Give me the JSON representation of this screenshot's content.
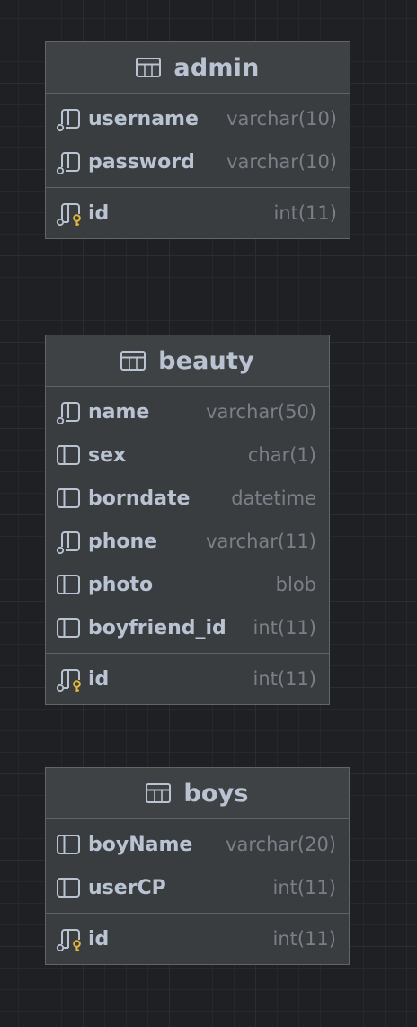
{
  "tables": [
    {
      "name": "admin",
      "columns": [
        {
          "name": "username",
          "type": "varchar(10)",
          "icon": "nullable-column-icon"
        },
        {
          "name": "password",
          "type": "varchar(10)",
          "icon": "nullable-column-icon"
        }
      ],
      "primary_key": [
        {
          "name": "id",
          "type": "int(11)",
          "icon": "primary-key-icon"
        }
      ]
    },
    {
      "name": "beauty",
      "columns": [
        {
          "name": "name",
          "type": "varchar(50)",
          "icon": "nullable-column-icon"
        },
        {
          "name": "sex",
          "type": "char(1)",
          "icon": "column-icon"
        },
        {
          "name": "borndate",
          "type": "datetime",
          "icon": "column-icon"
        },
        {
          "name": "phone",
          "type": "varchar(11)",
          "icon": "nullable-column-icon"
        },
        {
          "name": "photo",
          "type": "blob",
          "icon": "column-icon"
        },
        {
          "name": "boyfriend_id",
          "type": "int(11)",
          "icon": "column-icon"
        }
      ],
      "primary_key": [
        {
          "name": "id",
          "type": "int(11)",
          "icon": "primary-key-icon"
        }
      ]
    },
    {
      "name": "boys",
      "columns": [
        {
          "name": "boyName",
          "type": "varchar(20)",
          "icon": "column-icon"
        },
        {
          "name": "userCP",
          "type": "int(11)",
          "icon": "column-icon"
        }
      ],
      "primary_key": [
        {
          "name": "id",
          "type": "int(11)",
          "icon": "primary-key-icon"
        }
      ]
    }
  ],
  "colors": {
    "key": "#e2b93b",
    "text": "#b9c3d2",
    "type": "#7b8088"
  }
}
